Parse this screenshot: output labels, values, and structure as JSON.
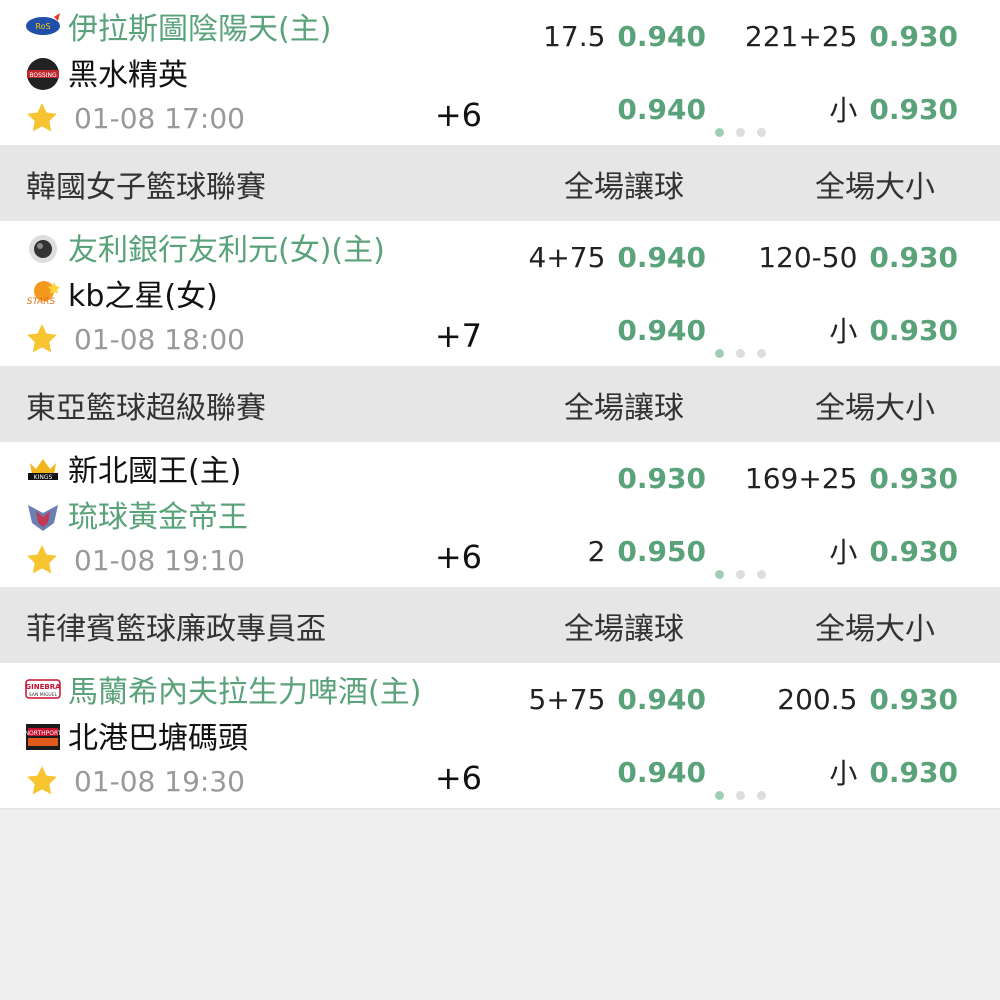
{
  "colors": {
    "accent": "#5aa27a",
    "header_bg": "#e6e6e6",
    "page_bg": "#efefef"
  },
  "matches_top": [
    {
      "home": "伊拉斯圖陰陽天(主)",
      "away": "黑水精英",
      "time": "01-08 17:00",
      "more": "+6",
      "home_logo": "rain-or-shine-logo",
      "away_logo": "bossing-logo",
      "hcp": [
        {
          "val": "17.5",
          "odds": "0.940"
        },
        {
          "val": "",
          "odds": "0.940"
        }
      ],
      "ou": [
        {
          "val": "221+25",
          "odds": "0.930"
        },
        {
          "val": "小",
          "odds": "0.930"
        }
      ]
    }
  ],
  "leagues": [
    {
      "name": "韓國女子籃球聯賽",
      "col1": "全場讓球",
      "col2": "全場大小",
      "match": {
        "home": "友利銀行友利元(女)(主)",
        "away": "kb之星(女)",
        "time": "01-08 18:00",
        "more": "+7",
        "hcp": [
          {
            "val": "4+75",
            "odds": "0.940"
          },
          {
            "val": "",
            "odds": "0.940"
          }
        ],
        "ou": [
          {
            "val": "120-50",
            "odds": "0.930"
          },
          {
            "val": "小",
            "odds": "0.930"
          }
        ]
      }
    },
    {
      "name": "東亞籃球超級聯賽",
      "col1": "全場讓球",
      "col2": "全場大小",
      "match": {
        "home": "新北國王(主)",
        "away": "琉球黃金帝王",
        "time": "01-08 19:10",
        "more": "+6",
        "hcp": [
          {
            "val": "",
            "odds": "0.930"
          },
          {
            "val": "2",
            "odds": "0.950"
          }
        ],
        "ou": [
          {
            "val": "169+25",
            "odds": "0.930"
          },
          {
            "val": "小",
            "odds": "0.930"
          }
        ]
      }
    },
    {
      "name": "菲律賓籃球廉政專員盃",
      "col1": "全場讓球",
      "col2": "全場大小",
      "match": {
        "home": "馬蘭希內夫拉生力啤酒(主)",
        "away": "北港巴塘碼頭",
        "time": "01-08 19:30",
        "more": "+6",
        "hcp": [
          {
            "val": "5+75",
            "odds": "0.940"
          },
          {
            "val": "",
            "odds": "0.940"
          }
        ],
        "ou": [
          {
            "val": "200.5",
            "odds": "0.930"
          },
          {
            "val": "小",
            "odds": "0.930"
          }
        ]
      }
    }
  ]
}
